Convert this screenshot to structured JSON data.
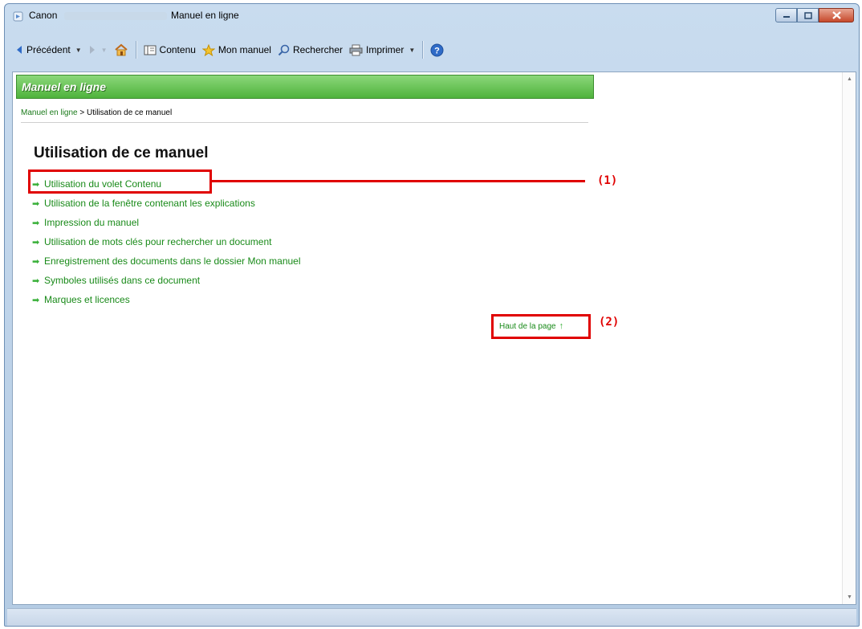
{
  "window": {
    "title_left": "Canon",
    "title_right": "Manuel en ligne"
  },
  "toolbar": {
    "back_label": "Précédent",
    "contents_label": "Contenu",
    "my_manual_label": "Mon manuel",
    "search_label": "Rechercher",
    "print_label": "Imprimer"
  },
  "page": {
    "header_title": "Manuel en ligne",
    "breadcrumb_link": "Manuel en ligne",
    "breadcrumb_sep": " > ",
    "breadcrumb_current": "Utilisation de ce manuel",
    "title": "Utilisation de ce manuel",
    "links": [
      "Utilisation du volet Contenu",
      "Utilisation de la fenêtre contenant les explications",
      "Impression du manuel",
      "Utilisation de mots clés pour rechercher un document",
      "Enregistrement des documents dans le dossier Mon manuel",
      "Symboles utilisés dans ce document",
      "Marques et licences"
    ],
    "top_link": "Haut de la page"
  },
  "annotations": {
    "label1": "(1)",
    "label2": "(2)"
  },
  "colors": {
    "link_green": "#198a19",
    "header_green": "#4fb33c",
    "annotation_red": "#e00000"
  }
}
